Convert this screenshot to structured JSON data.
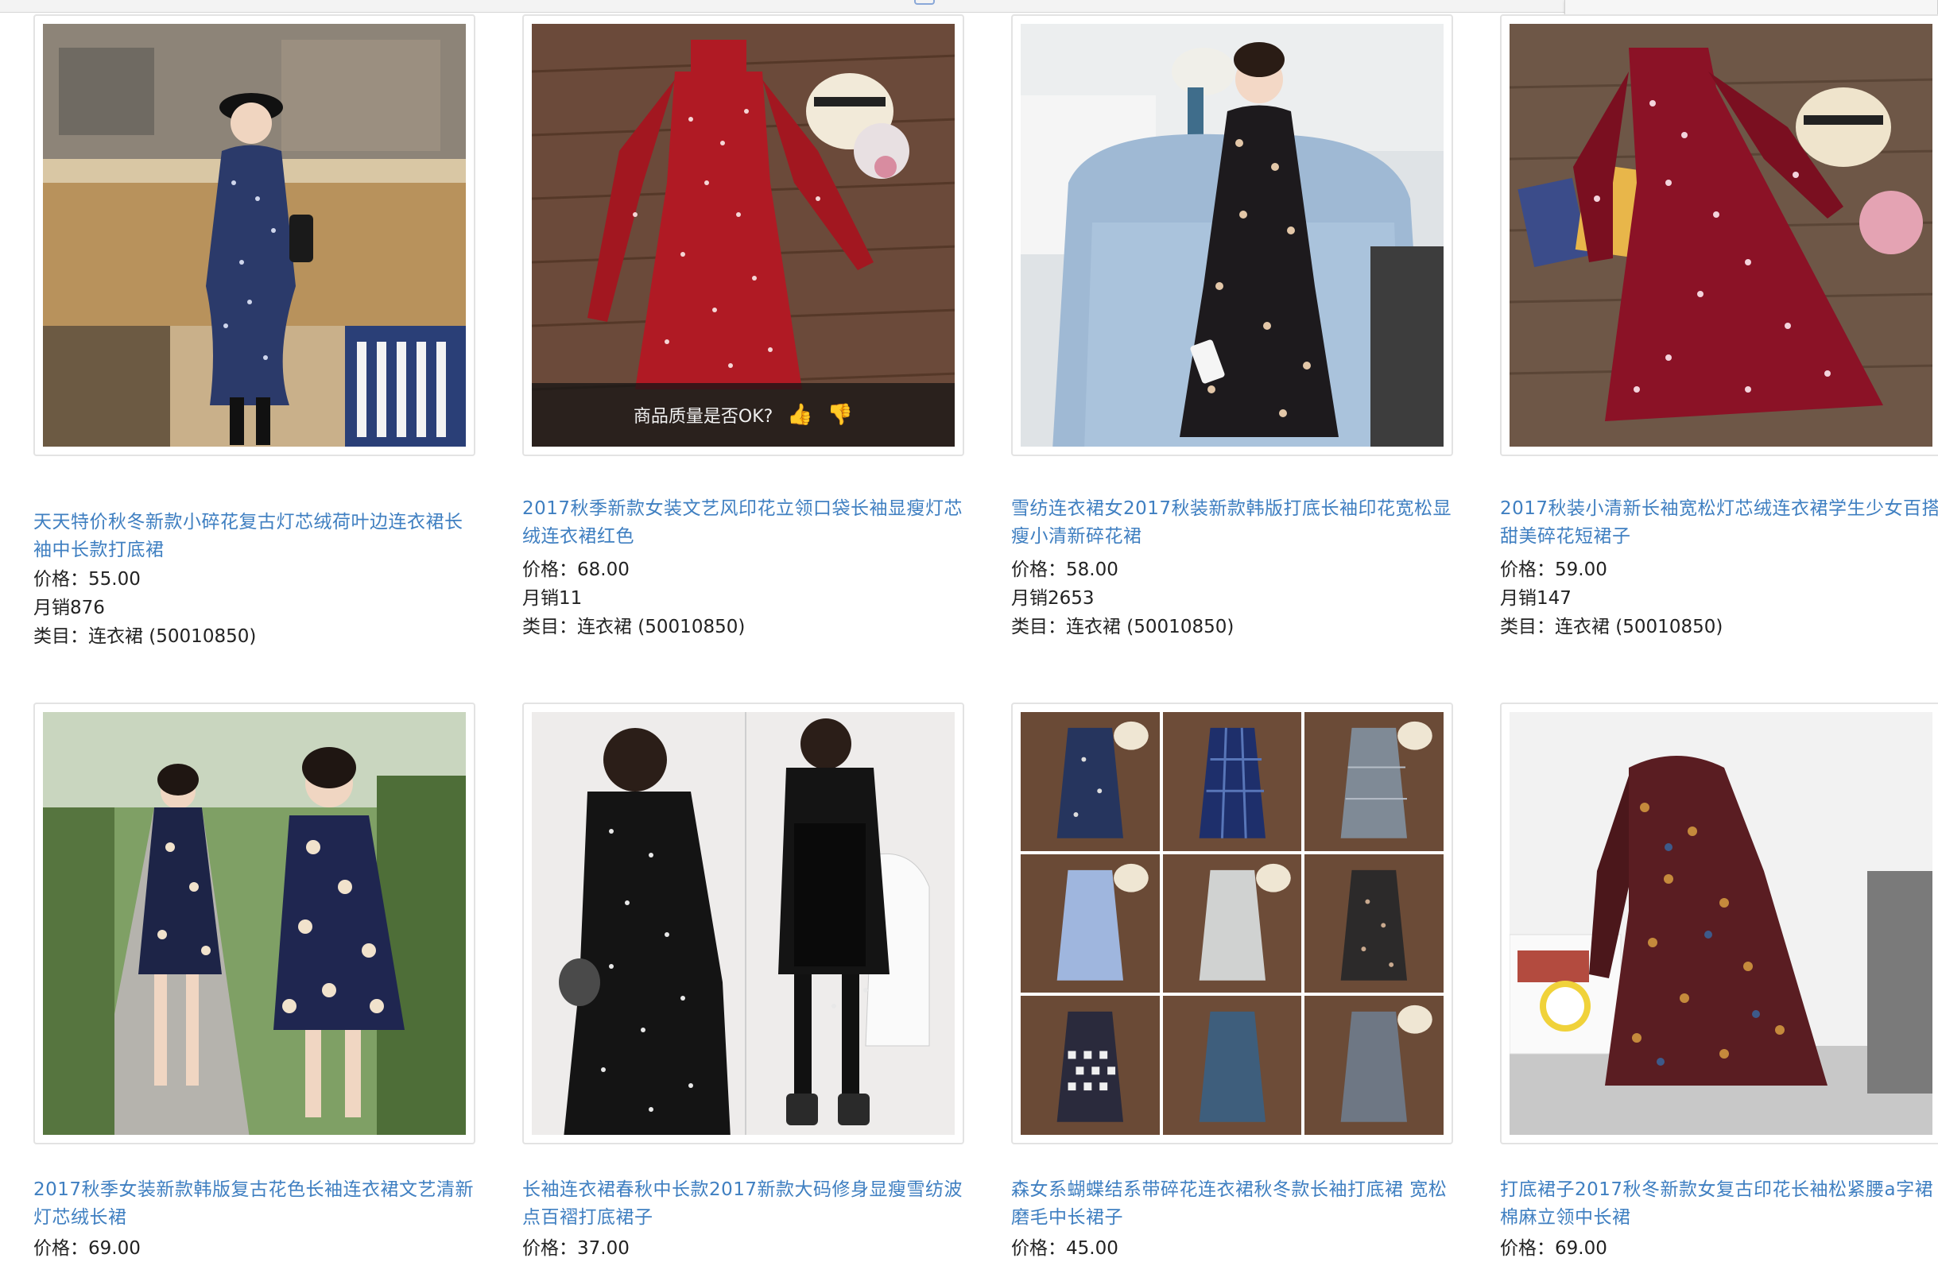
{
  "products": [
    {
      "title": "天天特价秋冬新款小碎花复古灯芯绒荷叶边连衣裙长袖中长款打底裙",
      "price": "价格：55.00",
      "sales": "月销876",
      "category": "类目：连衣裙 (50010850)",
      "image": "woman-blue-floral-dress-cafe-photo"
    },
    {
      "title": "2017秋季新款女装文艺风印花立领口袋长袖显瘦灯芯绒连衣裙红色",
      "price": "价格：68.00",
      "sales": "月销11",
      "category": "类目：连衣裙 (50010850)",
      "image": "red-polka-dot-dress-flatlay-photo",
      "overlay_text": "商品质量是否OK?"
    },
    {
      "title": "雪纺连衣裙女2017秋装新款韩版打底长袖印花宽松显瘦小清新碎花裙",
      "price": "价格：58.00",
      "sales": "月销2653",
      "category": "类目：连衣裙 (50010850)",
      "image": "woman-black-floral-dress-armchair-photo"
    },
    {
      "title": "2017秋装小清新长袖宽松灯芯绒连衣裙学生少女百搭甜美碎花短裙子",
      "price": "价格：59.00",
      "sales": "月销147",
      "category": "类目：连衣裙 (50010850)",
      "image": "burgundy-floral-dress-flatlay-photo"
    },
    {
      "title": "2017秋季女装新款韩版复古花色长袖连衣裙文艺清新灯芯绒长裙",
      "price": "价格：69.00",
      "image": "navy-floral-dress-outdoor-photo"
    },
    {
      "title": "长袖连衣裙春秋中长款2017新款大码修身显瘦雪纺波点百褶打底裙子",
      "price": "价格：37.00",
      "image": "black-dot-chiffon-dress-mirror-photo"
    },
    {
      "title": "森女系蝴蝶结系带碎花连衣裙秋冬款长袖打底裙 宽松磨毛中长裙子",
      "price": "价格：45.00",
      "image": "nine-dress-variants-collage"
    },
    {
      "title": "打底裙子2017秋冬新款女复古印花长袖松紧腰a字裙棉麻立领中长裙",
      "price": "价格：69.00",
      "image": "red-paisley-dress-mannequin-photo"
    }
  ],
  "colors": {
    "title_link": "#3f7fc1",
    "text": "#222222",
    "frame_border": "#e3e3e3"
  }
}
